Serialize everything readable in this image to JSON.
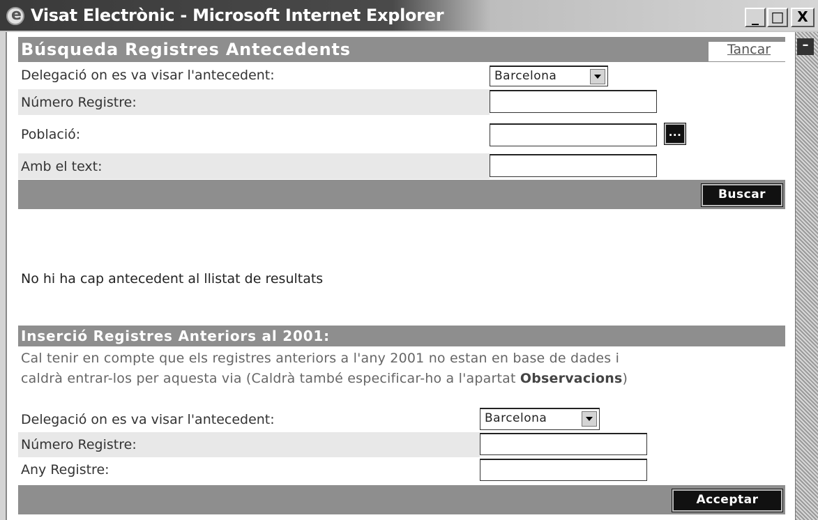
{
  "window": {
    "title": "Visat Electrònic - Microsoft Internet Explorer",
    "minimize": "_",
    "maximize": "□",
    "close": "X"
  },
  "search": {
    "title": "Búsqueda Registres Antecedents",
    "close_link": "Tancar",
    "delegation_label": "Delegació on es va visar l'antecedent:",
    "delegation_value": "Barcelona",
    "number_label": "Número Registre:",
    "number_value": "",
    "town_label": "Població:",
    "town_value": "",
    "town_button": "...",
    "text_label": "Amb el text:",
    "text_value": "",
    "search_button": "Buscar"
  },
  "results": {
    "message": "No hi ha cap antecedent al llistat de resultats"
  },
  "insert": {
    "title": "Inserció Registres Anteriors al 2001:",
    "note_line1": "Cal tenir en compte que els registres anteriors a l'any 2001 no estan en base de dades i",
    "note_line2_a": "caldrà entrar-los per aquesta via (Caldrà també especificar-ho a l'apartat ",
    "note_line2_b": "Observacions",
    "note_line2_c": ")",
    "delegation_label": "Delegació on es va visar l'antecedent:",
    "delegation_value": "Barcelona",
    "number_label": "Número Registre:",
    "number_value": "",
    "year_label": "Any Registre:",
    "year_value": "",
    "accept_button": "Acceptar"
  },
  "scrollbar": {
    "button": "–"
  },
  "colors": {
    "header_bg": "#8e8e8e",
    "row_shade": "#e8e8e8",
    "button_bg": "#111111"
  }
}
